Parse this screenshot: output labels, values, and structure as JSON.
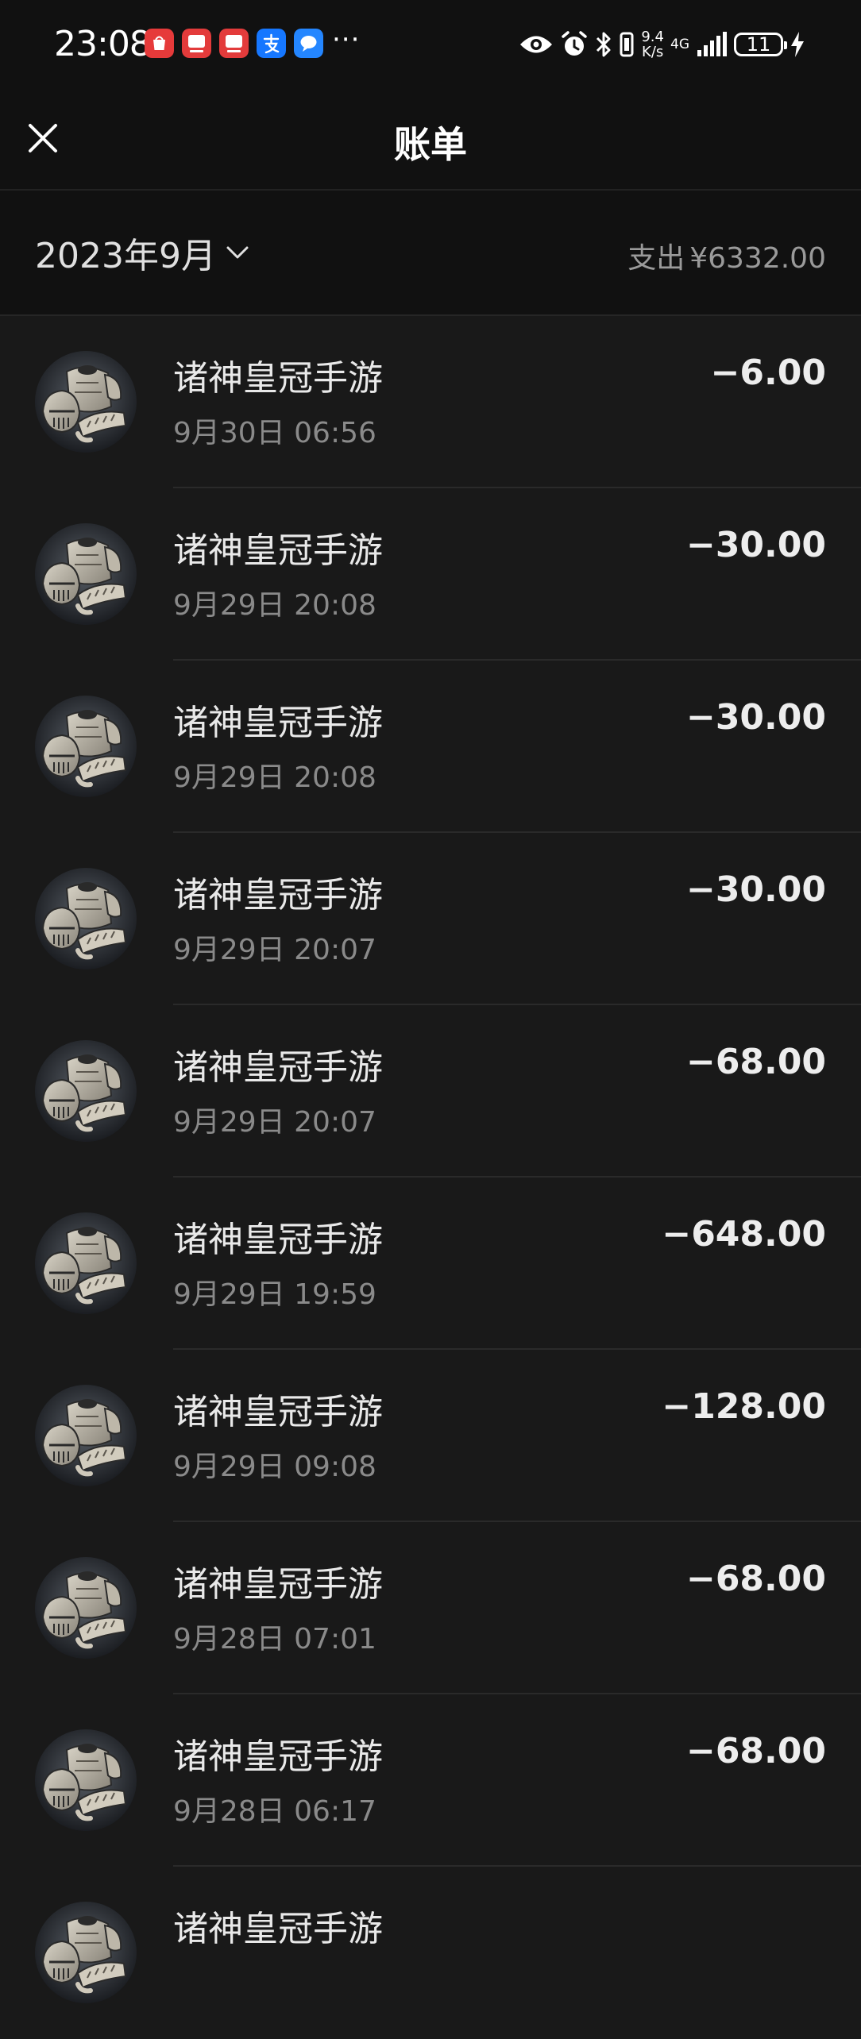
{
  "status_bar": {
    "time": "23:08",
    "more": "···",
    "net_speed_value": "9.4",
    "net_speed_unit": "K/s",
    "net_type": "4G",
    "battery": "11",
    "app_icons": [
      "shopping-app-icon",
      "reader-app-icon",
      "reader-app-icon",
      "alipay-icon",
      "message-app-icon"
    ],
    "right_icons": [
      "eye-icon",
      "alarm-icon",
      "bluetooth-icon",
      "vibrate-icon",
      "signal-icon",
      "charging-icon"
    ]
  },
  "header": {
    "title": "账单",
    "close_icon": "close-icon"
  },
  "month_bar": {
    "month": "2023年9月",
    "expense_label": "支出",
    "expense_amount": "¥6332.00"
  },
  "transactions": [
    {
      "merchant": "诸神皇冠手游",
      "time": "9月30日 06:56",
      "amount": "−6.00"
    },
    {
      "merchant": "诸神皇冠手游",
      "time": "9月29日 20:08",
      "amount": "−30.00"
    },
    {
      "merchant": "诸神皇冠手游",
      "time": "9月29日 20:08",
      "amount": "−30.00"
    },
    {
      "merchant": "诸神皇冠手游",
      "time": "9月29日 20:07",
      "amount": "−30.00"
    },
    {
      "merchant": "诸神皇冠手游",
      "time": "9月29日 20:07",
      "amount": "−68.00"
    },
    {
      "merchant": "诸神皇冠手游",
      "time": "9月29日 19:59",
      "amount": "−648.00"
    },
    {
      "merchant": "诸神皇冠手游",
      "time": "9月29日 09:08",
      "amount": "−128.00"
    },
    {
      "merchant": "诸神皇冠手游",
      "time": "9月28日 07:01",
      "amount": "−68.00"
    },
    {
      "merchant": "诸神皇冠手游",
      "time": "9月28日 06:17",
      "amount": "−68.00"
    },
    {
      "merchant": "诸神皇冠手游",
      "time": "",
      "amount": ""
    }
  ],
  "colors": {
    "background": "#191919",
    "header": "#111111",
    "text_primary": "#e9e9e9",
    "text_secondary": "#8a8a8a"
  }
}
